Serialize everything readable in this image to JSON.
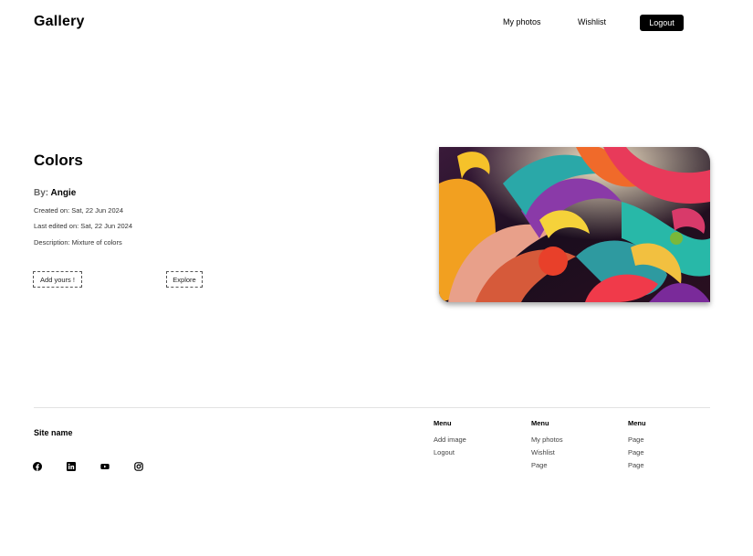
{
  "header": {
    "brand": "Gallery",
    "nav": {
      "my_photos": "My photos",
      "wishlist": "Wishlist"
    },
    "logout": "Logout"
  },
  "image_detail": {
    "title": "Colors",
    "by_label": "By:",
    "author": "Angie",
    "created": "Created on: Sat, 22 Jun 2024",
    "edited": "Last edited on: Sat, 22 Jun 2024",
    "description": "Description: Mixture of colors",
    "add_button": "Add yours !",
    "explore_button": "Explore"
  },
  "footer": {
    "site_name": "Site name",
    "social": [
      "facebook-icon",
      "linkedin-icon",
      "youtube-icon",
      "instagram-icon"
    ],
    "columns": [
      {
        "heading": "Menu",
        "links": [
          "Add image",
          "Logout"
        ]
      },
      {
        "heading": "Menu",
        "links": [
          "My photos",
          "Wishlist",
          "Page"
        ]
      },
      {
        "heading": "Menu",
        "links": [
          "Page",
          "Page",
          "Page"
        ]
      }
    ]
  },
  "colors": {
    "primary_button": "#000000",
    "divider": "#e2e2e2"
  }
}
